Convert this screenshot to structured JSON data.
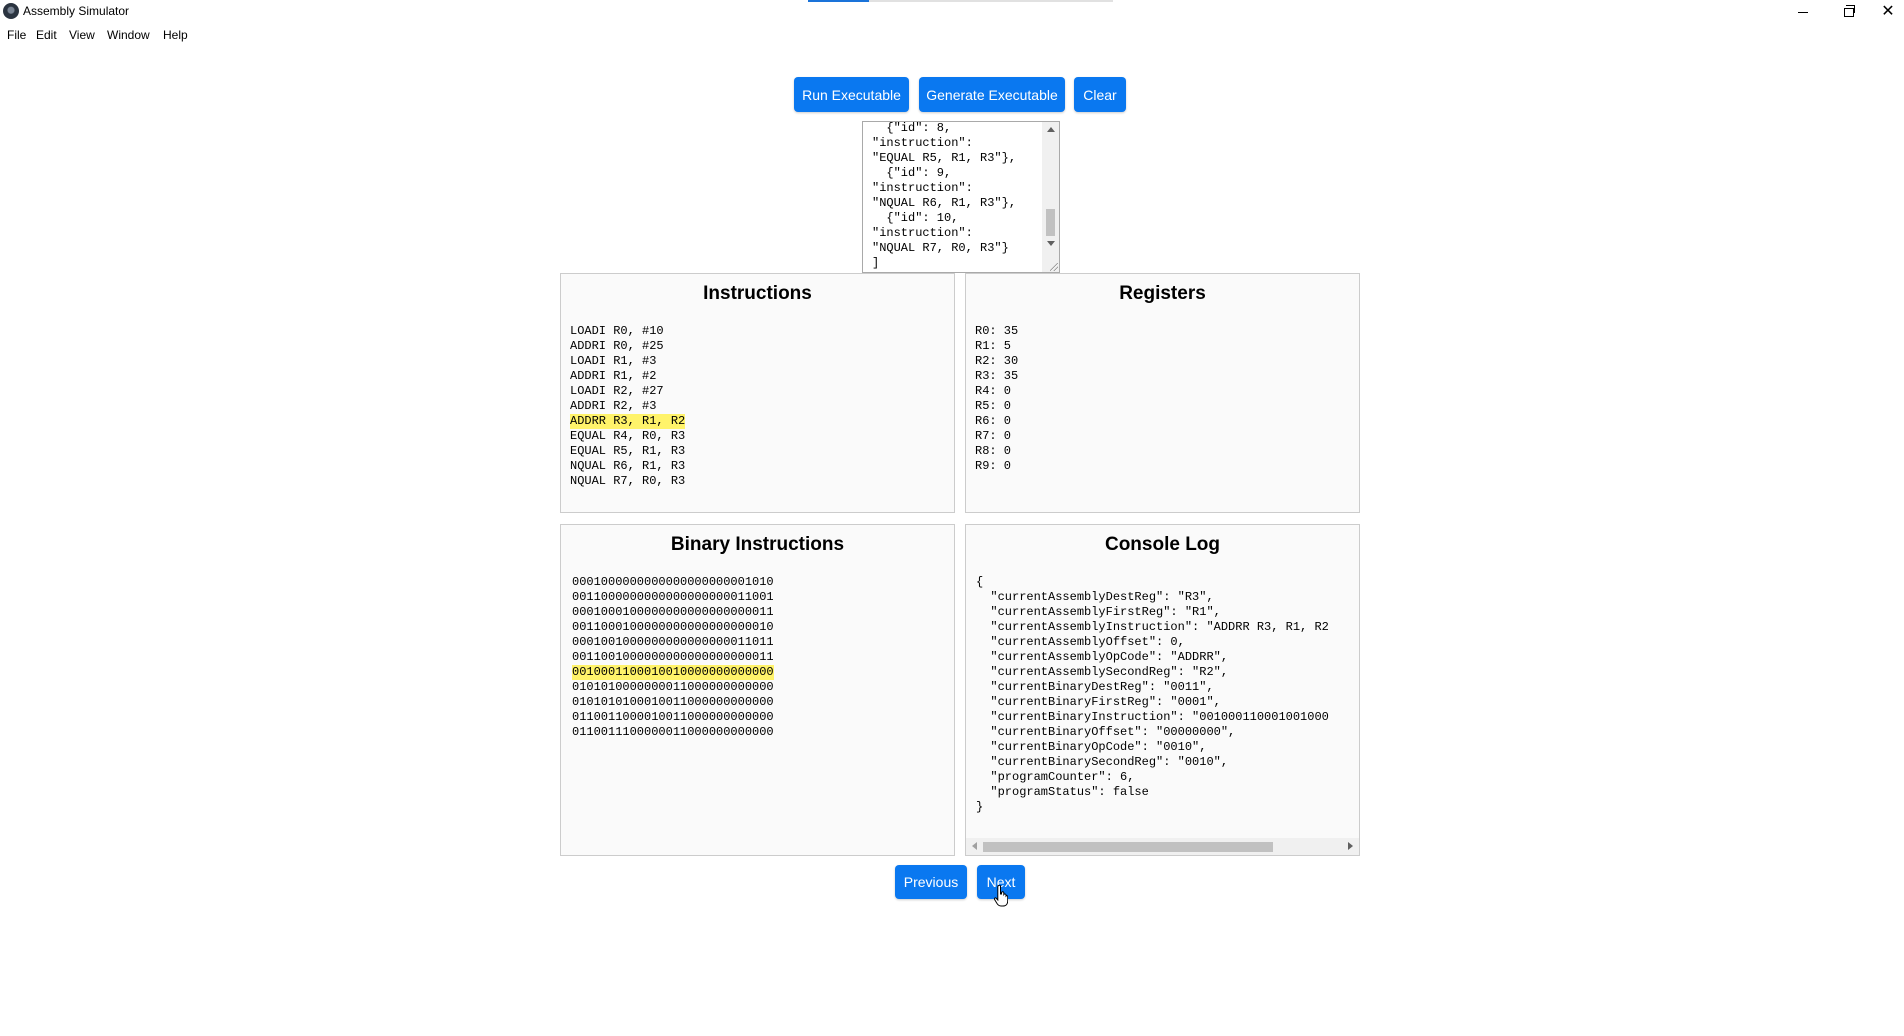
{
  "window": {
    "title": "Assembly Simulator",
    "loading_progress": 0.2
  },
  "menu": [
    "File",
    "Edit",
    "View",
    "Window",
    "Help"
  ],
  "toolbar": {
    "run_label": "Run Executable",
    "generate_label": "Generate Executable",
    "clear_label": "Clear"
  },
  "json_editor": {
    "lines": [
      "  {\"id\": 8,",
      "\"instruction\":",
      "\"EQUAL R5, R1, R3\"},",
      "  {\"id\": 9,",
      "\"instruction\":",
      "\"NQUAL R6, R1, R3\"},",
      "  {\"id\": 10,",
      "\"instruction\":",
      "\"NQUAL R7, R0, R3\"}",
      "]"
    ]
  },
  "instructions": {
    "title": "Instructions",
    "current_index": 6,
    "items": [
      "LOADI R0, #10",
      "ADDRI R0, #25",
      "LOADI R1, #3",
      "ADDRI R1, #2",
      "LOADI R2, #27",
      "ADDRI R2, #3",
      "ADDRR R3, R1, R2",
      "EQUAL R4, R0, R3",
      "EQUAL R5, R1, R3",
      "NQUAL R6, R1, R3",
      "NQUAL R7, R0, R3"
    ]
  },
  "registers": {
    "title": "Registers",
    "items": [
      "R0: 35",
      "R1: 5",
      "R2: 30",
      "R3: 35",
      "R4: 0",
      "R5: 0",
      "R6: 0",
      "R7: 0",
      "R8: 0",
      "R9: 0"
    ]
  },
  "binary": {
    "title": "Binary Instructions",
    "current_index": 6,
    "items": [
      "0001000000000000000000001010",
      "0011000000000000000000011001",
      "0001000100000000000000000011",
      "0011000100000000000000000010",
      "0001001000000000000000011011",
      "0011001000000000000000000011",
      "0010001100010010000000000000",
      "0101010000000011000000000000",
      "0101010100010011000000000000",
      "0110011000010011000000000000",
      "0110011100000011000000000000"
    ]
  },
  "console": {
    "title": "Console Log",
    "lines": [
      "{",
      "  \"currentAssemblyDestReg\": \"R3\",",
      "  \"currentAssemblyFirstReg\": \"R1\",",
      "  \"currentAssemblyInstruction\": \"ADDRR R3, R1, R2",
      "  \"currentAssemblyOffset\": 0,",
      "  \"currentAssemblyOpCode\": \"ADDRR\",",
      "  \"currentAssemblySecondReg\": \"R2\",",
      "  \"currentBinaryDestReg\": \"0011\",",
      "  \"currentBinaryFirstReg\": \"0001\",",
      "  \"currentBinaryInstruction\": \"001000110001001000",
      "  \"currentBinaryOffset\": \"00000000\",",
      "  \"currentBinaryOpCode\": \"0010\",",
      "  \"currentBinarySecondReg\": \"0010\",",
      "  \"programCounter\": 6,",
      "  \"programStatus\": false",
      "}"
    ]
  },
  "nav": {
    "previous_label": "Previous",
    "next_label": "Next"
  }
}
